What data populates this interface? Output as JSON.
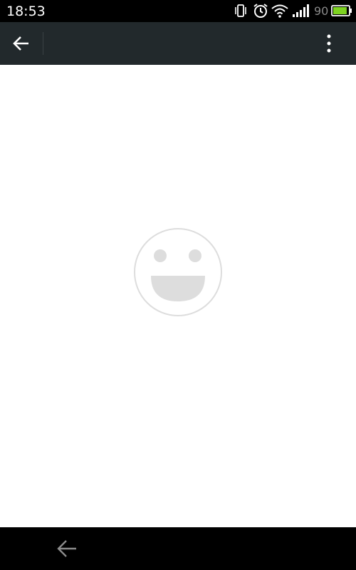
{
  "status_bar": {
    "time": "18:53",
    "battery_level": "90",
    "icons": [
      "vibrate-icon",
      "alarm-icon",
      "wifi-icon",
      "signal-icon",
      "battery-icon"
    ],
    "battery_color": "#7ed321"
  },
  "toolbar": {
    "background": "#22292c",
    "back_icon": "arrow-left-icon",
    "menu_icon": "more-vertical-icon"
  },
  "content": {
    "empty_state_icon": "smiley-face-icon",
    "icon_color": "#dddddd"
  },
  "nav_bar": {
    "back_icon": "arrow-left-icon"
  }
}
